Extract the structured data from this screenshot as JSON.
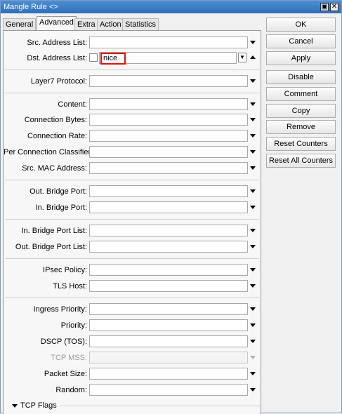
{
  "window": {
    "title": "Mangle Rule <>"
  },
  "tabs": [
    "General",
    "Advanced",
    "Extra",
    "Action",
    "Statistics"
  ],
  "active_tab": "Advanced",
  "fields": {
    "src_address_list": {
      "label": "Src. Address List:",
      "value": ""
    },
    "dst_address_list": {
      "label": "Dst. Address List:",
      "value": "nice",
      "negate_checked": false
    },
    "layer7_protocol": {
      "label": "Layer7 Protocol:",
      "value": ""
    },
    "content": {
      "label": "Content:",
      "value": ""
    },
    "connection_bytes": {
      "label": "Connection Bytes:",
      "value": ""
    },
    "connection_rate": {
      "label": "Connection Rate:",
      "value": ""
    },
    "per_connection_classifier": {
      "label": "Per Connection Classifier:",
      "value": ""
    },
    "src_mac_address": {
      "label": "Src. MAC Address:",
      "value": ""
    },
    "out_bridge_port": {
      "label": "Out. Bridge Port:",
      "value": ""
    },
    "in_bridge_port": {
      "label": "In. Bridge Port:",
      "value": ""
    },
    "in_bridge_port_list": {
      "label": "In. Bridge Port List:",
      "value": ""
    },
    "out_bridge_port_list": {
      "label": "Out. Bridge Port List:",
      "value": ""
    },
    "ipsec_policy": {
      "label": "IPsec Policy:",
      "value": ""
    },
    "tls_host": {
      "label": "TLS Host:",
      "value": ""
    },
    "ingress_priority": {
      "label": "Ingress Priority:",
      "value": ""
    },
    "priority": {
      "label": "Priority:",
      "value": ""
    },
    "dscp": {
      "label": "DSCP (TOS):",
      "value": ""
    },
    "tcp_mss": {
      "label": "TCP MSS:",
      "value": "",
      "disabled": true
    },
    "packet_size": {
      "label": "Packet Size:",
      "value": ""
    },
    "random": {
      "label": "Random:",
      "value": ""
    }
  },
  "section": {
    "tcp_flags": "TCP Flags"
  },
  "buttons": {
    "ok": "OK",
    "cancel": "Cancel",
    "apply": "Apply",
    "disable": "Disable",
    "comment": "Comment",
    "copy": "Copy",
    "remove": "Remove",
    "reset_counters": "Reset Counters",
    "reset_all_counters": "Reset All Counters"
  },
  "icons": {
    "dropdown": "chevron-down-icon",
    "up": "chevron-up-icon",
    "restore": "restore-icon",
    "close": "close-icon"
  },
  "colors": {
    "titlebar": "#3f7fc6",
    "highlight": "#e01010"
  }
}
